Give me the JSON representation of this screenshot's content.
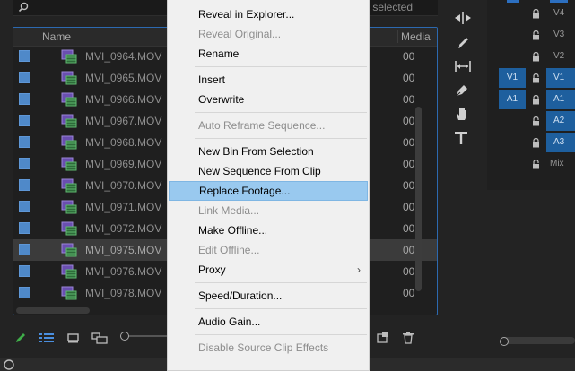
{
  "project": {
    "status_text": "ms selected",
    "columns": {
      "name": "Name",
      "media": "Media"
    },
    "rows": [
      {
        "name": "MVI_0964.MOV",
        "media": "00",
        "selected": false
      },
      {
        "name": "MVI_0965.MOV",
        "media": "00",
        "selected": false
      },
      {
        "name": "MVI_0966.MOV",
        "media": "00",
        "selected": false
      },
      {
        "name": "MVI_0967.MOV",
        "media": "00",
        "selected": false
      },
      {
        "name": "MVI_0968.MOV",
        "media": "00",
        "selected": false
      },
      {
        "name": "MVI_0969.MOV",
        "media": "00",
        "selected": false
      },
      {
        "name": "MVI_0970.MOV",
        "media": "00",
        "selected": false
      },
      {
        "name": "MVI_0971.MOV",
        "media": "00",
        "selected": false
      },
      {
        "name": "MVI_0972.MOV",
        "media": "00",
        "selected": false
      },
      {
        "name": "MVI_0975.MOV",
        "media": "00",
        "selected": true
      },
      {
        "name": "MVI_0976.MOV",
        "media": "00",
        "selected": false
      },
      {
        "name": "MVI_0978.MOV",
        "media": "00",
        "selected": false
      }
    ],
    "colors": {
      "label_swatch": "#4f89c9",
      "clip_icon": "#6a4fb0",
      "accent_border": "#2c69b0"
    }
  },
  "bottom_bar": {
    "icons": [
      "pencil-icon",
      "list-view-icon",
      "icon-view-icon",
      "freeform-view-icon",
      "zoom-slider",
      "new-bin-icon",
      "trash-icon"
    ]
  },
  "tools": {
    "icons": [
      "ripple-edit-icon",
      "razor-icon",
      "slip-icon",
      "pen-icon",
      "hand-icon",
      "type-icon"
    ]
  },
  "timeline": {
    "tracks": [
      {
        "id": "v4",
        "label": "V4",
        "source": "",
        "locked": true
      },
      {
        "id": "v3",
        "label": "V3",
        "source": "",
        "locked": true
      },
      {
        "id": "v2",
        "label": "V2",
        "source": "",
        "locked": true
      },
      {
        "id": "v1",
        "label": "V1",
        "source": "V1",
        "locked": true
      },
      {
        "id": "a1",
        "label": "A1",
        "source": "A1",
        "locked": true
      },
      {
        "id": "a2",
        "label": "A2",
        "source": "",
        "locked": true
      },
      {
        "id": "a3",
        "label": "A3",
        "source": "",
        "locked": true
      },
      {
        "id": "mix",
        "label": "Mix",
        "source": "",
        "locked": true
      }
    ]
  },
  "context_menu": {
    "items": [
      {
        "label": "Reveal in Explorer...",
        "enabled": true
      },
      {
        "label": "Reveal Original...",
        "enabled": false
      },
      {
        "label": "Rename",
        "enabled": true
      },
      {
        "separator": true
      },
      {
        "label": "Insert",
        "enabled": true
      },
      {
        "label": "Overwrite",
        "enabled": true
      },
      {
        "separator": true
      },
      {
        "label": "Auto Reframe Sequence...",
        "enabled": false
      },
      {
        "separator": true
      },
      {
        "label": "New Bin From Selection",
        "enabled": true
      },
      {
        "label": "New Sequence From Clip",
        "enabled": true
      },
      {
        "label": "Replace Footage...",
        "enabled": true,
        "highlighted": true
      },
      {
        "label": "Link Media...",
        "enabled": false
      },
      {
        "label": "Make Offline...",
        "enabled": true
      },
      {
        "label": "Edit Offline...",
        "enabled": false
      },
      {
        "label": "Proxy",
        "enabled": true,
        "submenu": true
      },
      {
        "separator": true
      },
      {
        "label": "Speed/Duration...",
        "enabled": true
      },
      {
        "separator": true
      },
      {
        "label": "Audio Gain...",
        "enabled": true
      },
      {
        "separator": true
      },
      {
        "label": "Disable Source Clip Effects",
        "enabled": false
      }
    ],
    "highlight_color": "#99c9ef"
  }
}
